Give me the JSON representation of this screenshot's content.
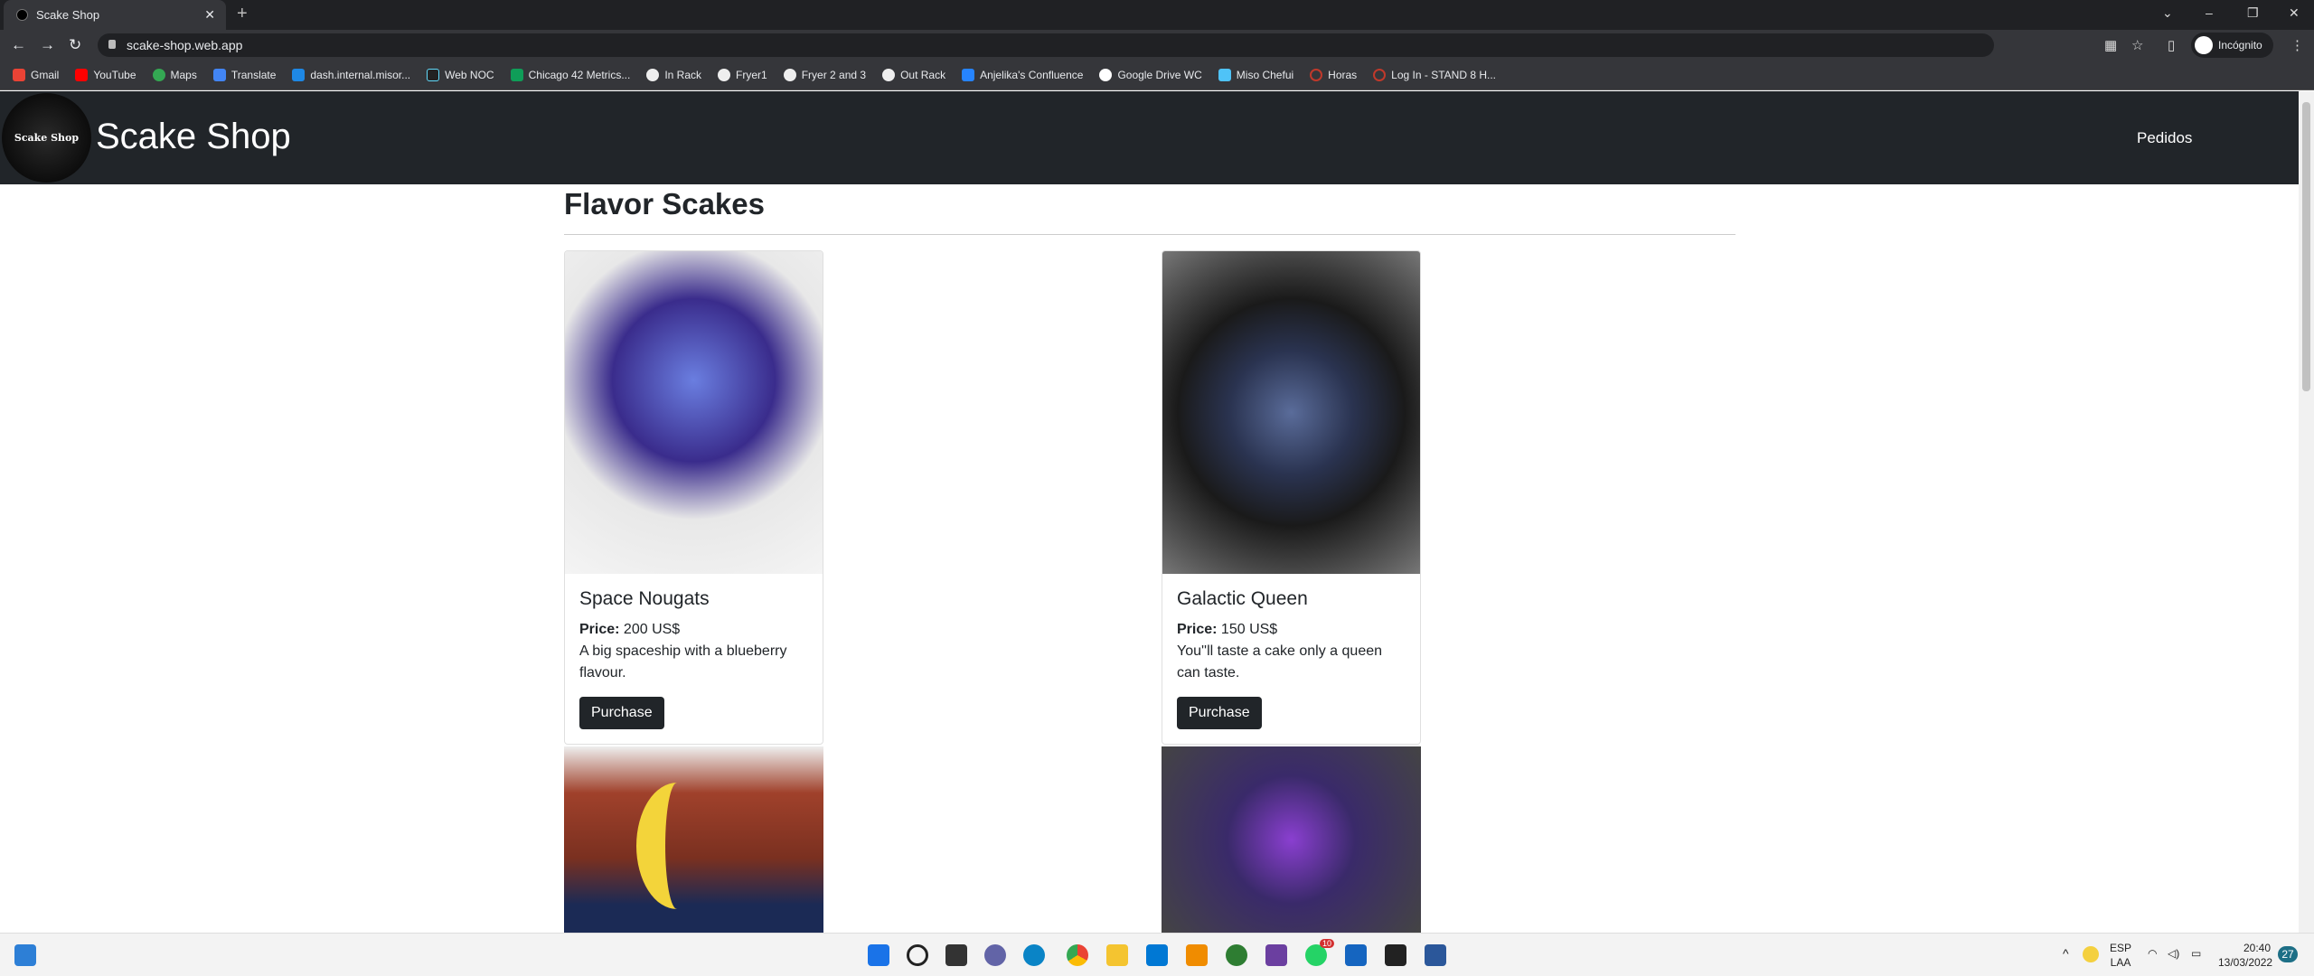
{
  "browser": {
    "tab_title": "Scake Shop",
    "url": "scake-shop.web.app",
    "profile": "Incógnito",
    "bookmarks": [
      "Gmail",
      "YouTube",
      "Maps",
      "Translate",
      "dash.internal.misor...",
      "Web NOC",
      "Chicago 42 Metrics...",
      "In Rack",
      "Fryer1",
      "Fryer 2 and 3",
      "Out Rack",
      "Anjelika's Confluence",
      "Google Drive WC",
      "Miso Chefui",
      "Horas",
      "Log In - STAND 8 H..."
    ]
  },
  "header": {
    "logo_text": "Scake Shop",
    "brand": "Scake Shop",
    "nav_orders": "Pedidos"
  },
  "main": {
    "title": "Flavor Scakes",
    "price_label": "Price:",
    "products": [
      {
        "name": "Space Nougats",
        "price": "200 US$",
        "description": "A big spaceship with a blueberry flavour.",
        "button": "Purchase"
      },
      {
        "name": "Galactic Queen",
        "price": "150 US$",
        "description": "You''ll taste a cake only a queen can taste.",
        "button": "Purchase"
      }
    ]
  },
  "taskbar": {
    "lang1": "ESP",
    "lang2": "LAA",
    "time": "20:40",
    "date": "13/03/2022",
    "notifications": "27",
    "whatsapp_badge": "10"
  }
}
